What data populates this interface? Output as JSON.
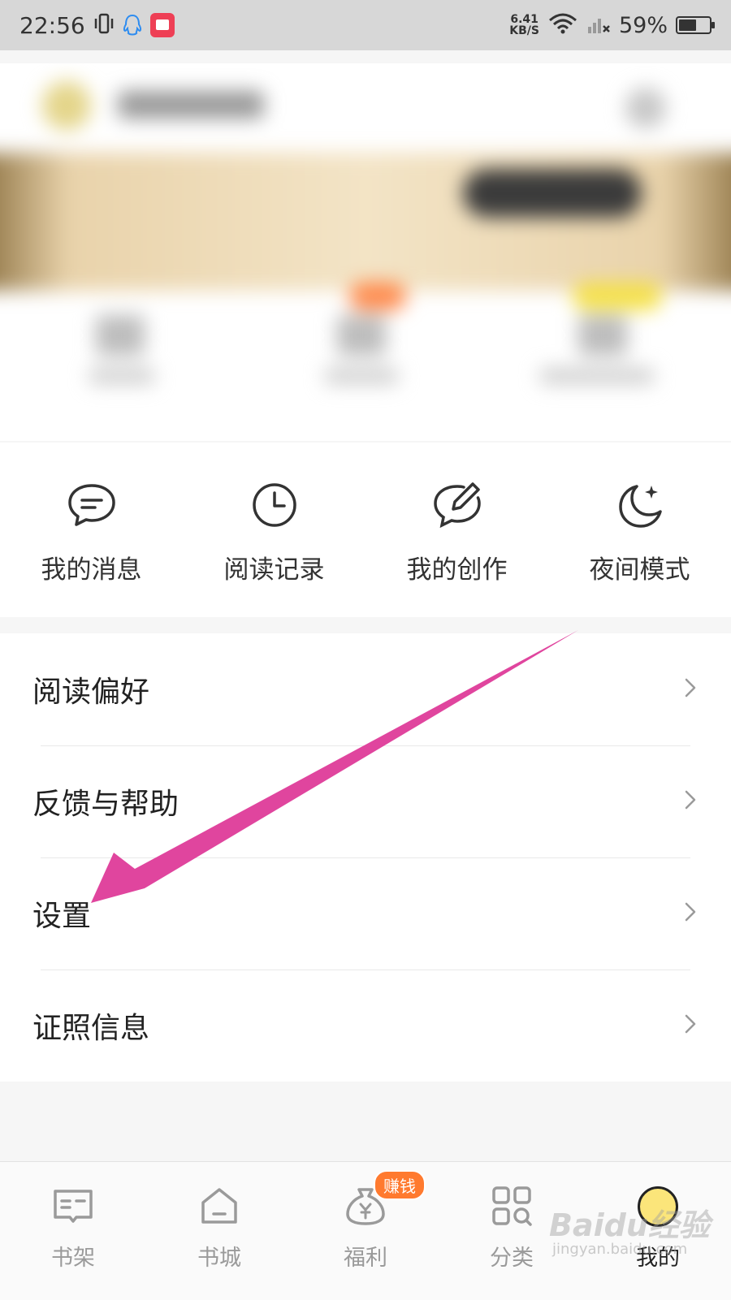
{
  "status_bar": {
    "time": "22:56",
    "net_speed_value": "6.41",
    "net_speed_unit": "KB/S",
    "battery_percent": "59%",
    "battery_level": 0.59,
    "icons": [
      "vibrate-icon",
      "qq-icon",
      "reader-app-icon",
      "wifi-icon",
      "signal-icon",
      "battery-icon"
    ]
  },
  "quick_actions": [
    {
      "label": "我的消息",
      "icon": "message-bubble-icon"
    },
    {
      "label": "阅读记录",
      "icon": "clock-icon"
    },
    {
      "label": "我的创作",
      "icon": "edit-bubble-icon"
    },
    {
      "label": "夜间模式",
      "icon": "moon-icon"
    }
  ],
  "menu": [
    {
      "label": "阅读偏好"
    },
    {
      "label": "反馈与帮助"
    },
    {
      "label": "设置"
    },
    {
      "label": "证照信息"
    }
  ],
  "tabbar": {
    "tabs": [
      {
        "label": "书架",
        "icon": "bookshelf-icon"
      },
      {
        "label": "书城",
        "icon": "home-icon"
      },
      {
        "label": "福利",
        "icon": "money-bag-icon",
        "badge": "赚钱"
      },
      {
        "label": "分类",
        "icon": "category-icon"
      },
      {
        "label": "我的",
        "icon": "profile-icon",
        "active": true
      }
    ]
  },
  "watermark": {
    "text": "Baidu经验",
    "sub": "jingyan.baidu.com"
  },
  "colors": {
    "accent_orange": "#ff7a2f",
    "arrow_magenta": "#e0459e",
    "avatar_yellow": "#fbe57a"
  }
}
